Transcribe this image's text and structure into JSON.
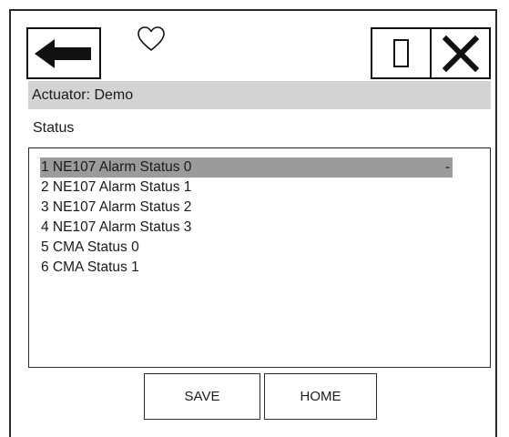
{
  "header": {
    "icons": [
      "back-arrow-icon",
      "heart-icon",
      "square-icon",
      "close-icon"
    ]
  },
  "title_bar": {
    "label": "Actuator: Demo"
  },
  "section": {
    "label": "Status"
  },
  "list": {
    "items": [
      {
        "label": "1 NE107 Alarm Status 0",
        "value": "-",
        "selected": true
      },
      {
        "label": "2 NE107 Alarm Status 1"
      },
      {
        "label": "3 NE107 Alarm Status 2"
      },
      {
        "label": "4 NE107 Alarm Status 3"
      },
      {
        "label": "5 CMA Status 0"
      },
      {
        "label": "6 CMA Status 1"
      }
    ]
  },
  "buttons": {
    "save_label": "SAVE",
    "home_label": "HOME"
  },
  "colors": {
    "title_bar_bg": "#d3d3d3",
    "selected_row_bg": "#9b9b9b",
    "border": "#2a2a2a"
  }
}
